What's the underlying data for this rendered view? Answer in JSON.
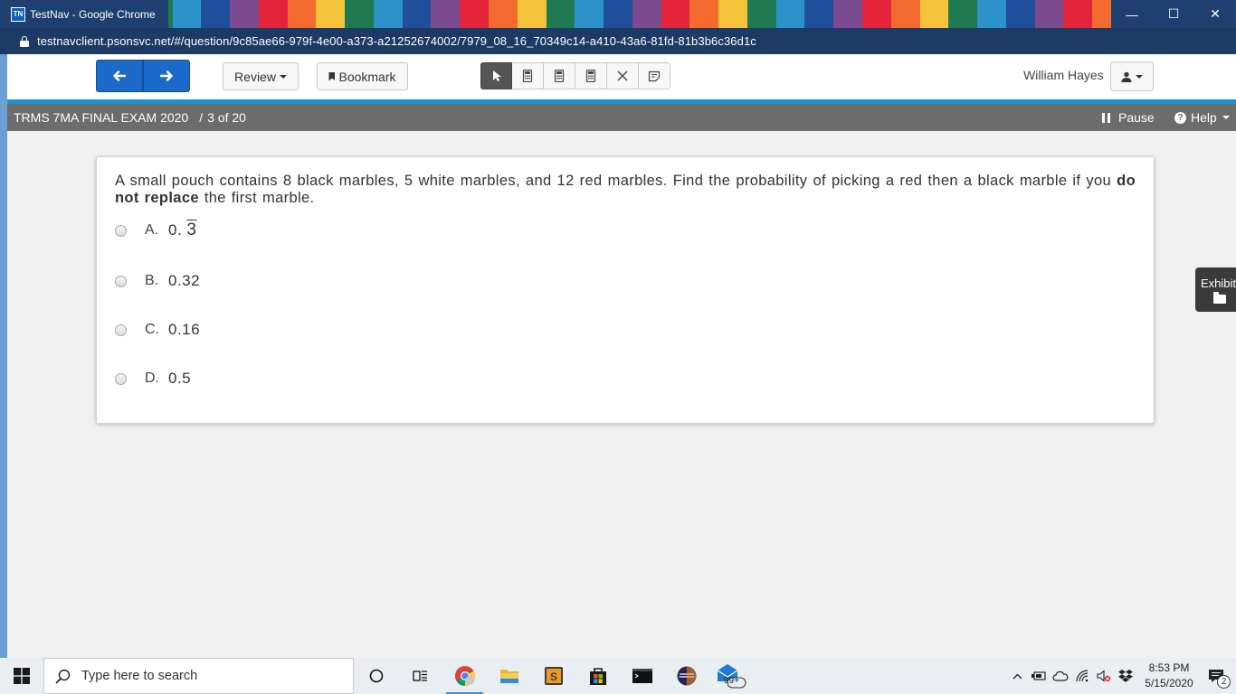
{
  "browser": {
    "tab_title": "TestNav - Google Chrome",
    "favicon_text": "TN",
    "url": "testnavclient.psonsvc.net/#/question/9c85ae66-979f-4e00-a373-a21252674002/7979_08_16_70349c14-a410-43a6-81fd-81b3b6c36d1c",
    "window_controls": {
      "minimize": "—",
      "maximize": "☐",
      "close": "✕"
    },
    "title_stripe_colors": [
      "#1e3f6f",
      "#7b4a8f",
      "#e3243b",
      "#f26a2e",
      "#f5c33a",
      "#1f7a52",
      "#2b93c9",
      "#1f4e9b",
      "#7b4a8f",
      "#e3243b",
      "#f26a2e",
      "#f5c33a",
      "#1f7a52",
      "#2b93c9",
      "#1f4e9b",
      "#7b4a8f",
      "#e3243b",
      "#f26a2e",
      "#f5c33a",
      "#1f7a52",
      "#2b93c9",
      "#1f4e9b",
      "#7b4a8f",
      "#e3243b",
      "#f26a2e",
      "#f5c33a",
      "#1f7a52",
      "#2b93c9",
      "#1f4e9b",
      "#7b4a8f",
      "#e3243b",
      "#f26a2e",
      "#f5c33a",
      "#1f7a52",
      "#2b93c9",
      "#1f4e9b",
      "#7b4a8f",
      "#e3243b",
      "#f26a2e",
      "#f5c33a",
      "#1f7a52",
      "#2b93c9",
      "#1f4e9b"
    ]
  },
  "toolbar": {
    "review_label": "Review",
    "bookmark_label": "Bookmark",
    "tools": [
      "pointer-icon",
      "calculator-icon",
      "calculator-icon",
      "calculator-icon",
      "answer-eliminator-icon",
      "notepad-icon"
    ],
    "user_name": "William Hayes"
  },
  "infobar": {
    "test_name": "TRMS 7MA FINAL EXAM 2020",
    "separator": "/",
    "progress": "3 of 20",
    "pause_label": "Pause",
    "help_label": "Help"
  },
  "question": {
    "text_before": "A small pouch contains 8 black marbles, 5 white marbles, and 12 red marbles. Find the probability of picking a red then a black marble if you",
    "text_bold": "do not replace",
    "text_after": "the first marble.",
    "options": [
      {
        "letter": "A.",
        "value_prefix": "0.",
        "value_repeating": "3"
      },
      {
        "letter": "B.",
        "value": "0.32"
      },
      {
        "letter": "C.",
        "value": "0.16"
      },
      {
        "letter": "D.",
        "value": "0.5"
      }
    ]
  },
  "exhibits": {
    "label": "Exhibits"
  },
  "taskbar": {
    "search_placeholder": "Type here to search",
    "mail_badge": "99+",
    "time": "8:53 PM",
    "date": "5/15/2020",
    "notification_count": "2"
  },
  "colors": {
    "nav_blue": "#1b6ac9",
    "accent_line": "#1e90d8",
    "infobar_gray": "#6c6c6c"
  }
}
